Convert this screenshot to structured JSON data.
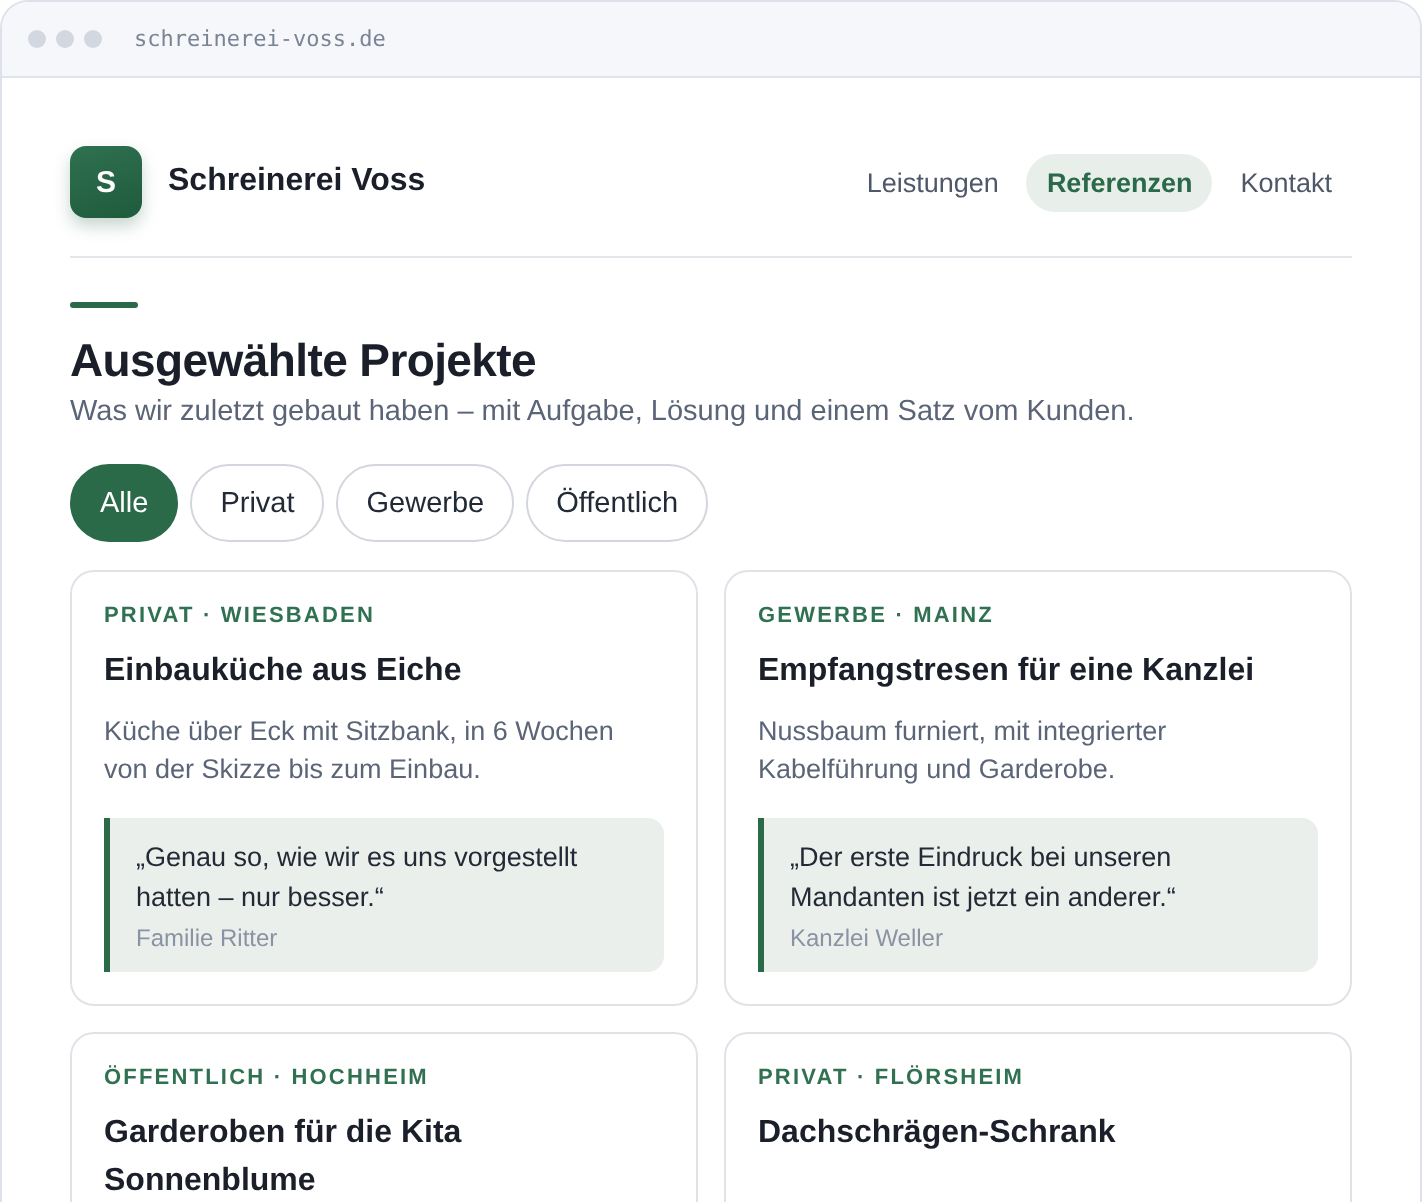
{
  "browser": {
    "url": "schreinerei-voss.de"
  },
  "header": {
    "logo_letter": "S",
    "brand": "Schreinerei Voss",
    "nav": [
      {
        "label": "Leistungen",
        "selected": false
      },
      {
        "label": "Referenzen",
        "selected": true
      },
      {
        "label": "Kontakt",
        "selected": false
      }
    ]
  },
  "section": {
    "title": "Ausgewählte Projekte",
    "subtitle": "Was wir zuletzt gebaut haben – mit Aufgabe, Lösung und einem Satz vom Kunden."
  },
  "filters": [
    {
      "label": "Alle",
      "selected": true
    },
    {
      "label": "Privat",
      "selected": false
    },
    {
      "label": "Gewerbe",
      "selected": false
    },
    {
      "label": "Öffentlich",
      "selected": false
    }
  ],
  "projects": [
    {
      "tag": "PRIVAT · WIESBADEN",
      "title": "Einbauküche aus Eiche",
      "description": "Küche über Eck mit Sitzbank, in 6 Wochen von der Skizze bis zum Einbau.",
      "quote": "„Genau so, wie wir es uns vorgestellt hatten – nur besser.“",
      "author": "Familie Ritter"
    },
    {
      "tag": "GEWERBE · MAINZ",
      "title": "Empfangstresen für eine Kanzlei",
      "description": "Nussbaum furniert, mit integrierter Kabelführung und Garderobe.",
      "quote": "„Der erste Eindruck bei unseren Mandanten ist jetzt ein anderer.“",
      "author": "Kanzlei Weller"
    },
    {
      "tag": "ÖFFENTLICH · HOCHHEIM",
      "title": "Garderoben für die Kita Sonnenblume"
    },
    {
      "tag": "PRIVAT · FLÖRSHEIM",
      "title": "Dachschrägen-Schrank"
    }
  ]
}
